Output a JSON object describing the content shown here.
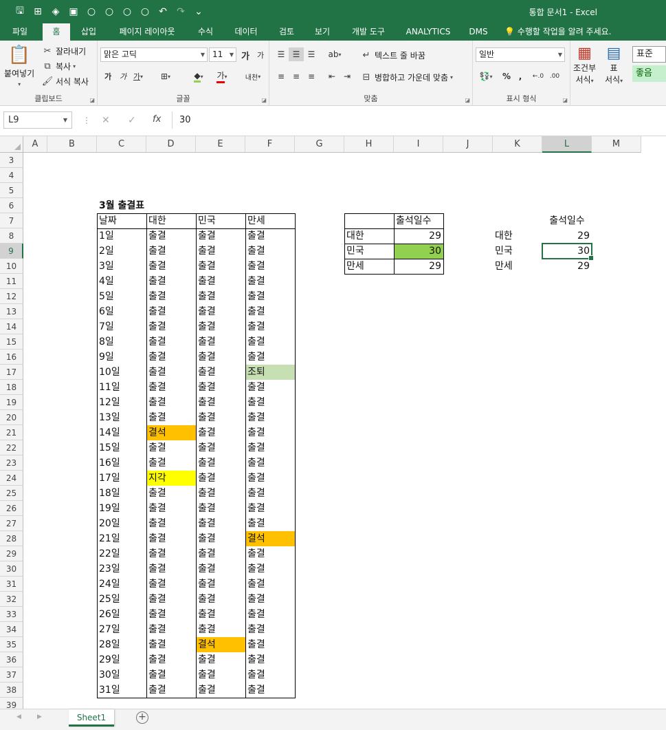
{
  "window": {
    "title": "통합 문서1 - Excel"
  },
  "tabs": [
    "파일",
    "홈",
    "삽입",
    "페이지 레이아웃",
    "수식",
    "데이터",
    "검토",
    "보기",
    "개발 도구",
    "ANALYTICS",
    "DMS",
    "수행할 작업을 알려 주세요."
  ],
  "ribbon": {
    "clipboard": {
      "paste": "붙여넣기",
      "cut": "잘라내기",
      "copy": "복사",
      "format_painter": "서식 복사",
      "label": "클립보드"
    },
    "font": {
      "name": "맑은 고딕",
      "size": "11",
      "label": "글꼴",
      "bold": "가",
      "italic": "가",
      "underline": "가",
      "grow": "가",
      "shrink": "가",
      "color": "가",
      "phonetic": "내천"
    },
    "alignment": {
      "wrap": "텍스트 줄 바꿈",
      "merge": "병합하고 가운데 맞춤",
      "label": "맞춤"
    },
    "number": {
      "format": "일반",
      "percent": "%",
      "comma": ",",
      "label": "표시 형식"
    },
    "styles": {
      "conditional": "조건부",
      "conditional2": "서식",
      "table": "표",
      "table2": "서식",
      "normal": "표준",
      "good": "좋음"
    }
  },
  "formula_bar": {
    "name_box": "L9",
    "fx": "fx",
    "value": "30"
  },
  "columns": [
    "A",
    "B",
    "C",
    "D",
    "E",
    "F",
    "G",
    "H",
    "I",
    "J",
    "K",
    "L",
    "M"
  ],
  "rows": [
    "3",
    "4",
    "5",
    "6",
    "7",
    "8",
    "9",
    "10",
    "11",
    "12",
    "13",
    "14",
    "15",
    "16",
    "17",
    "18",
    "19",
    "20",
    "21",
    "22",
    "23",
    "24",
    "25",
    "26",
    "27",
    "28",
    "29",
    "30",
    "31",
    "32",
    "33",
    "34",
    "35",
    "36",
    "37",
    "38",
    "39"
  ],
  "selected": {
    "col": "L",
    "row": "9"
  },
  "attendance": {
    "title": "3월 출결표",
    "headers": [
      "날짜",
      "대한",
      "민국",
      "만세"
    ],
    "records": [
      [
        "1일",
        "출결",
        "출결",
        "출결"
      ],
      [
        "2일",
        "출결",
        "출결",
        "출결"
      ],
      [
        "3일",
        "출결",
        "출결",
        "출결"
      ],
      [
        "4일",
        "출결",
        "출결",
        "출결"
      ],
      [
        "5일",
        "출결",
        "출결",
        "출결"
      ],
      [
        "6일",
        "출결",
        "출결",
        "출결"
      ],
      [
        "7일",
        "출결",
        "출결",
        "출결"
      ],
      [
        "8일",
        "출결",
        "출결",
        "출결"
      ],
      [
        "9일",
        "출결",
        "출결",
        "출결"
      ],
      [
        "10일",
        "출결",
        "출결",
        "조퇴"
      ],
      [
        "11일",
        "출결",
        "출결",
        "출결"
      ],
      [
        "12일",
        "출결",
        "출결",
        "출결"
      ],
      [
        "13일",
        "출결",
        "출결",
        "출결"
      ],
      [
        "14일",
        "결석",
        "출결",
        "출결"
      ],
      [
        "15일",
        "출결",
        "출결",
        "출결"
      ],
      [
        "16일",
        "출결",
        "출결",
        "출결"
      ],
      [
        "17일",
        "지각",
        "출결",
        "출결"
      ],
      [
        "18일",
        "출결",
        "출결",
        "출결"
      ],
      [
        "19일",
        "출결",
        "출결",
        "출결"
      ],
      [
        "20일",
        "출결",
        "출결",
        "출결"
      ],
      [
        "21일",
        "출결",
        "출결",
        "결석"
      ],
      [
        "22일",
        "출결",
        "출결",
        "출결"
      ],
      [
        "23일",
        "출결",
        "출결",
        "출결"
      ],
      [
        "24일",
        "출결",
        "출결",
        "출결"
      ],
      [
        "25일",
        "출결",
        "출결",
        "출결"
      ],
      [
        "26일",
        "출결",
        "출결",
        "출결"
      ],
      [
        "27일",
        "출결",
        "출결",
        "출결"
      ],
      [
        "28일",
        "출결",
        "결석",
        "출결"
      ],
      [
        "29일",
        "출결",
        "출결",
        "출결"
      ],
      [
        "30일",
        "출결",
        "출결",
        "출결"
      ],
      [
        "31일",
        "출결",
        "출결",
        "출결"
      ]
    ],
    "highlight_colors": {
      "결석": "#FFC000",
      "지각": "#FFFF00",
      "조퇴": "#C6E0B4"
    }
  },
  "summary1": {
    "header": "출석일수",
    "rows": [
      [
        "대한",
        "29"
      ],
      [
        "민국",
        "30"
      ],
      [
        "만세",
        "29"
      ]
    ],
    "highlight_color": "#92D050"
  },
  "summary2": {
    "header": "출석일수",
    "rows": [
      [
        "대한",
        "29"
      ],
      [
        "민국",
        "30"
      ],
      [
        "만세",
        "29"
      ]
    ]
  },
  "sheet_tabs": [
    "Sheet1"
  ],
  "colors": {
    "accent": "#217346"
  }
}
